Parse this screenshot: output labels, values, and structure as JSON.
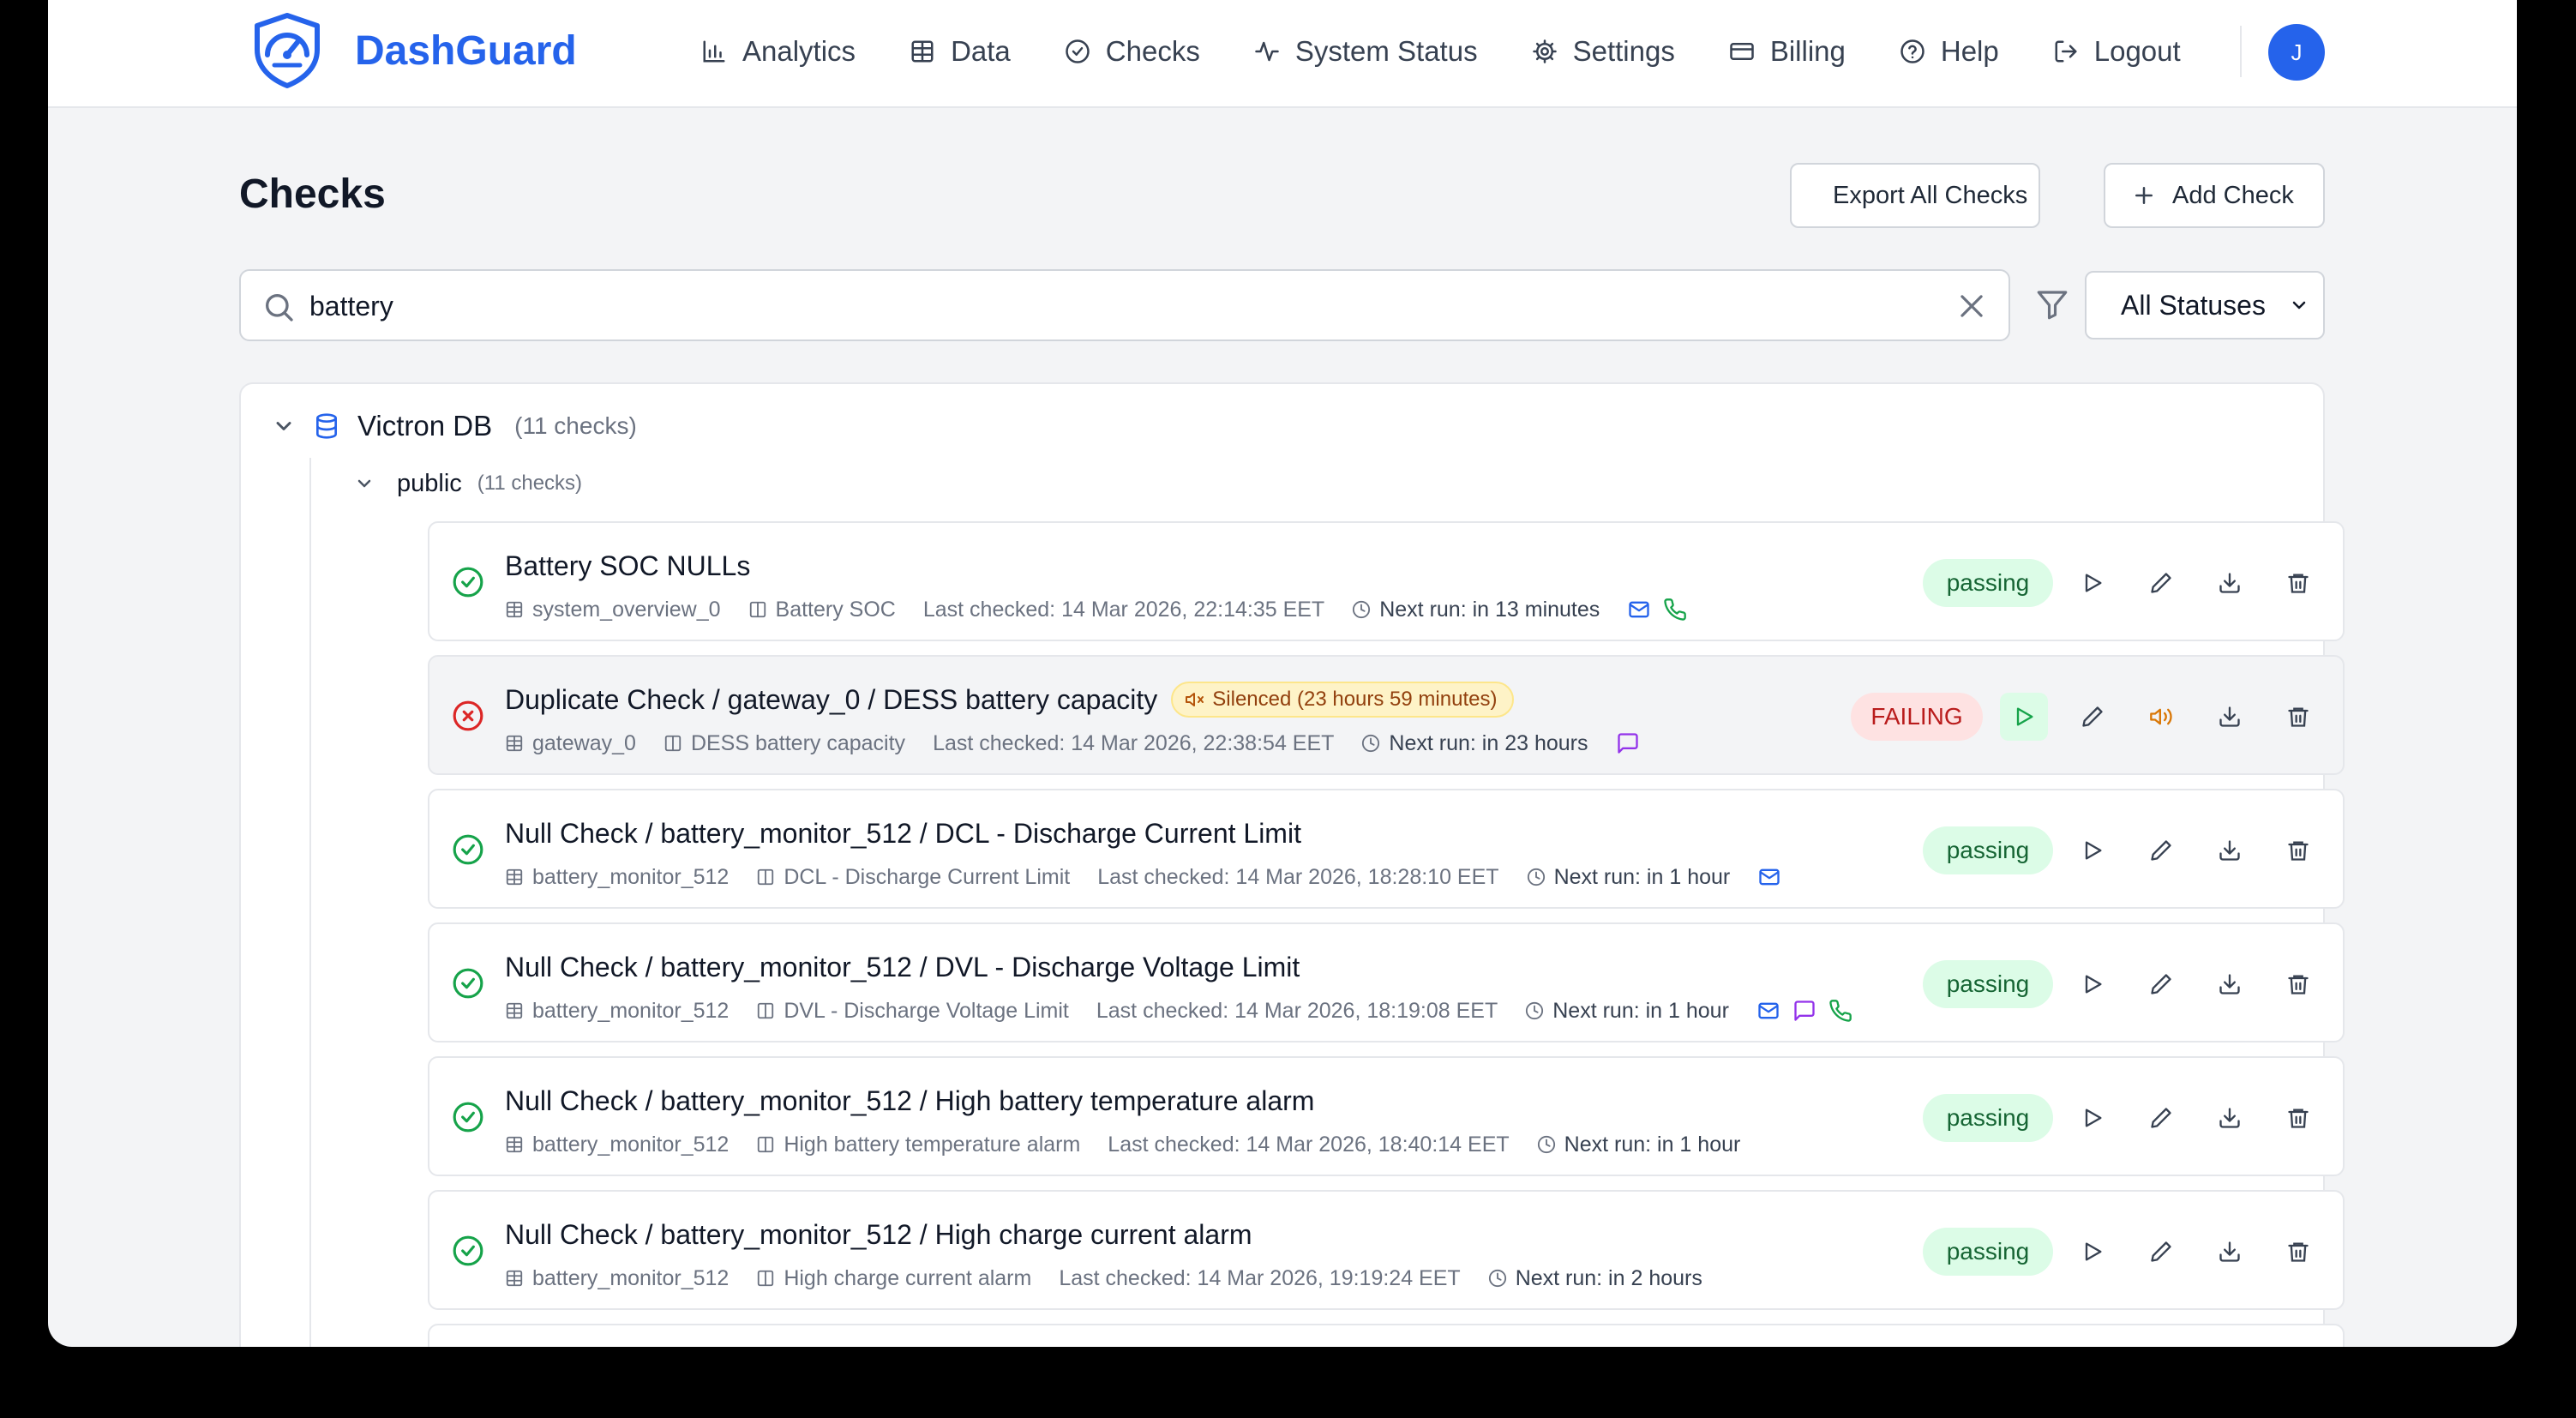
{
  "app": {
    "brand": "DashGuard",
    "avatar_initial": "J",
    "accent": "#2563eb"
  },
  "nav": [
    {
      "label": "Analytics",
      "icon": "bar-chart-icon"
    },
    {
      "label": "Data",
      "icon": "table-icon"
    },
    {
      "label": "Checks",
      "icon": "check-circle-icon"
    },
    {
      "label": "System Status",
      "icon": "activity-icon"
    },
    {
      "label": "Settings",
      "icon": "gear-icon"
    },
    {
      "label": "Billing",
      "icon": "credit-card-icon"
    },
    {
      "label": "Help",
      "icon": "help-circle-icon"
    },
    {
      "label": "Logout",
      "icon": "logout-icon"
    }
  ],
  "page": {
    "title": "Checks",
    "export_label": "Export All Checks",
    "add_label": "Add Check"
  },
  "search": {
    "value": "battery"
  },
  "filter": {
    "status_selected": "All Statuses"
  },
  "tree": {
    "db_name": "Victron DB",
    "db_count": "(11 checks)",
    "schema_name": "public",
    "schema_count": "(11 checks)"
  },
  "checks": [
    {
      "status": "passing",
      "status_label": "passing",
      "title": "Battery SOC NULLs",
      "table": "system_overview_0",
      "column": "Battery SOC",
      "last_checked": "Last checked: 14 Mar 2026, 22:14:35 EET",
      "next_run": "Next run: in 13 minutes",
      "channels": [
        "mail-icon",
        "phone-icon"
      ]
    },
    {
      "status": "failing",
      "status_label": "FAILING",
      "title": "Duplicate Check / gateway_0 / DESS battery capacity",
      "silenced": "Silenced (23 hours 59 minutes)",
      "table": "gateway_0",
      "column": "DESS battery capacity",
      "last_checked": "Last checked: 14 Mar 2026, 22:38:54 EET",
      "next_run": "Next run: in 23 hours",
      "channels": [
        "chat-icon"
      ]
    },
    {
      "status": "passing",
      "status_label": "passing",
      "title": "Null Check / battery_monitor_512 / DCL - Discharge Current Limit",
      "table": "battery_monitor_512",
      "column": "DCL - Discharge Current Limit",
      "last_checked": "Last checked: 14 Mar 2026, 18:28:10 EET",
      "next_run": "Next run: in 1 hour",
      "channels": [
        "mail-icon"
      ]
    },
    {
      "status": "passing",
      "status_label": "passing",
      "title": "Null Check / battery_monitor_512 / DVL - Discharge Voltage Limit",
      "table": "battery_monitor_512",
      "column": "DVL - Discharge Voltage Limit",
      "last_checked": "Last checked: 14 Mar 2026, 18:19:08 EET",
      "next_run": "Next run: in 1 hour",
      "channels": [
        "mail-icon",
        "chat-icon",
        "phone-icon"
      ]
    },
    {
      "status": "passing",
      "status_label": "passing",
      "title": "Null Check / battery_monitor_512 / High battery temperature alarm",
      "table": "battery_monitor_512",
      "column": "High battery temperature alarm",
      "last_checked": "Last checked: 14 Mar 2026, 18:40:14 EET",
      "next_run": "Next run: in 1 hour",
      "channels": []
    },
    {
      "status": "passing",
      "status_label": "passing",
      "title": "Null Check / battery_monitor_512 / High charge current alarm",
      "table": "battery_monitor_512",
      "column": "High charge current alarm",
      "last_checked": "Last checked: 14 Mar 2026, 19:19:24 EET",
      "next_run": "Next run: in 2 hours",
      "channels": []
    }
  ]
}
